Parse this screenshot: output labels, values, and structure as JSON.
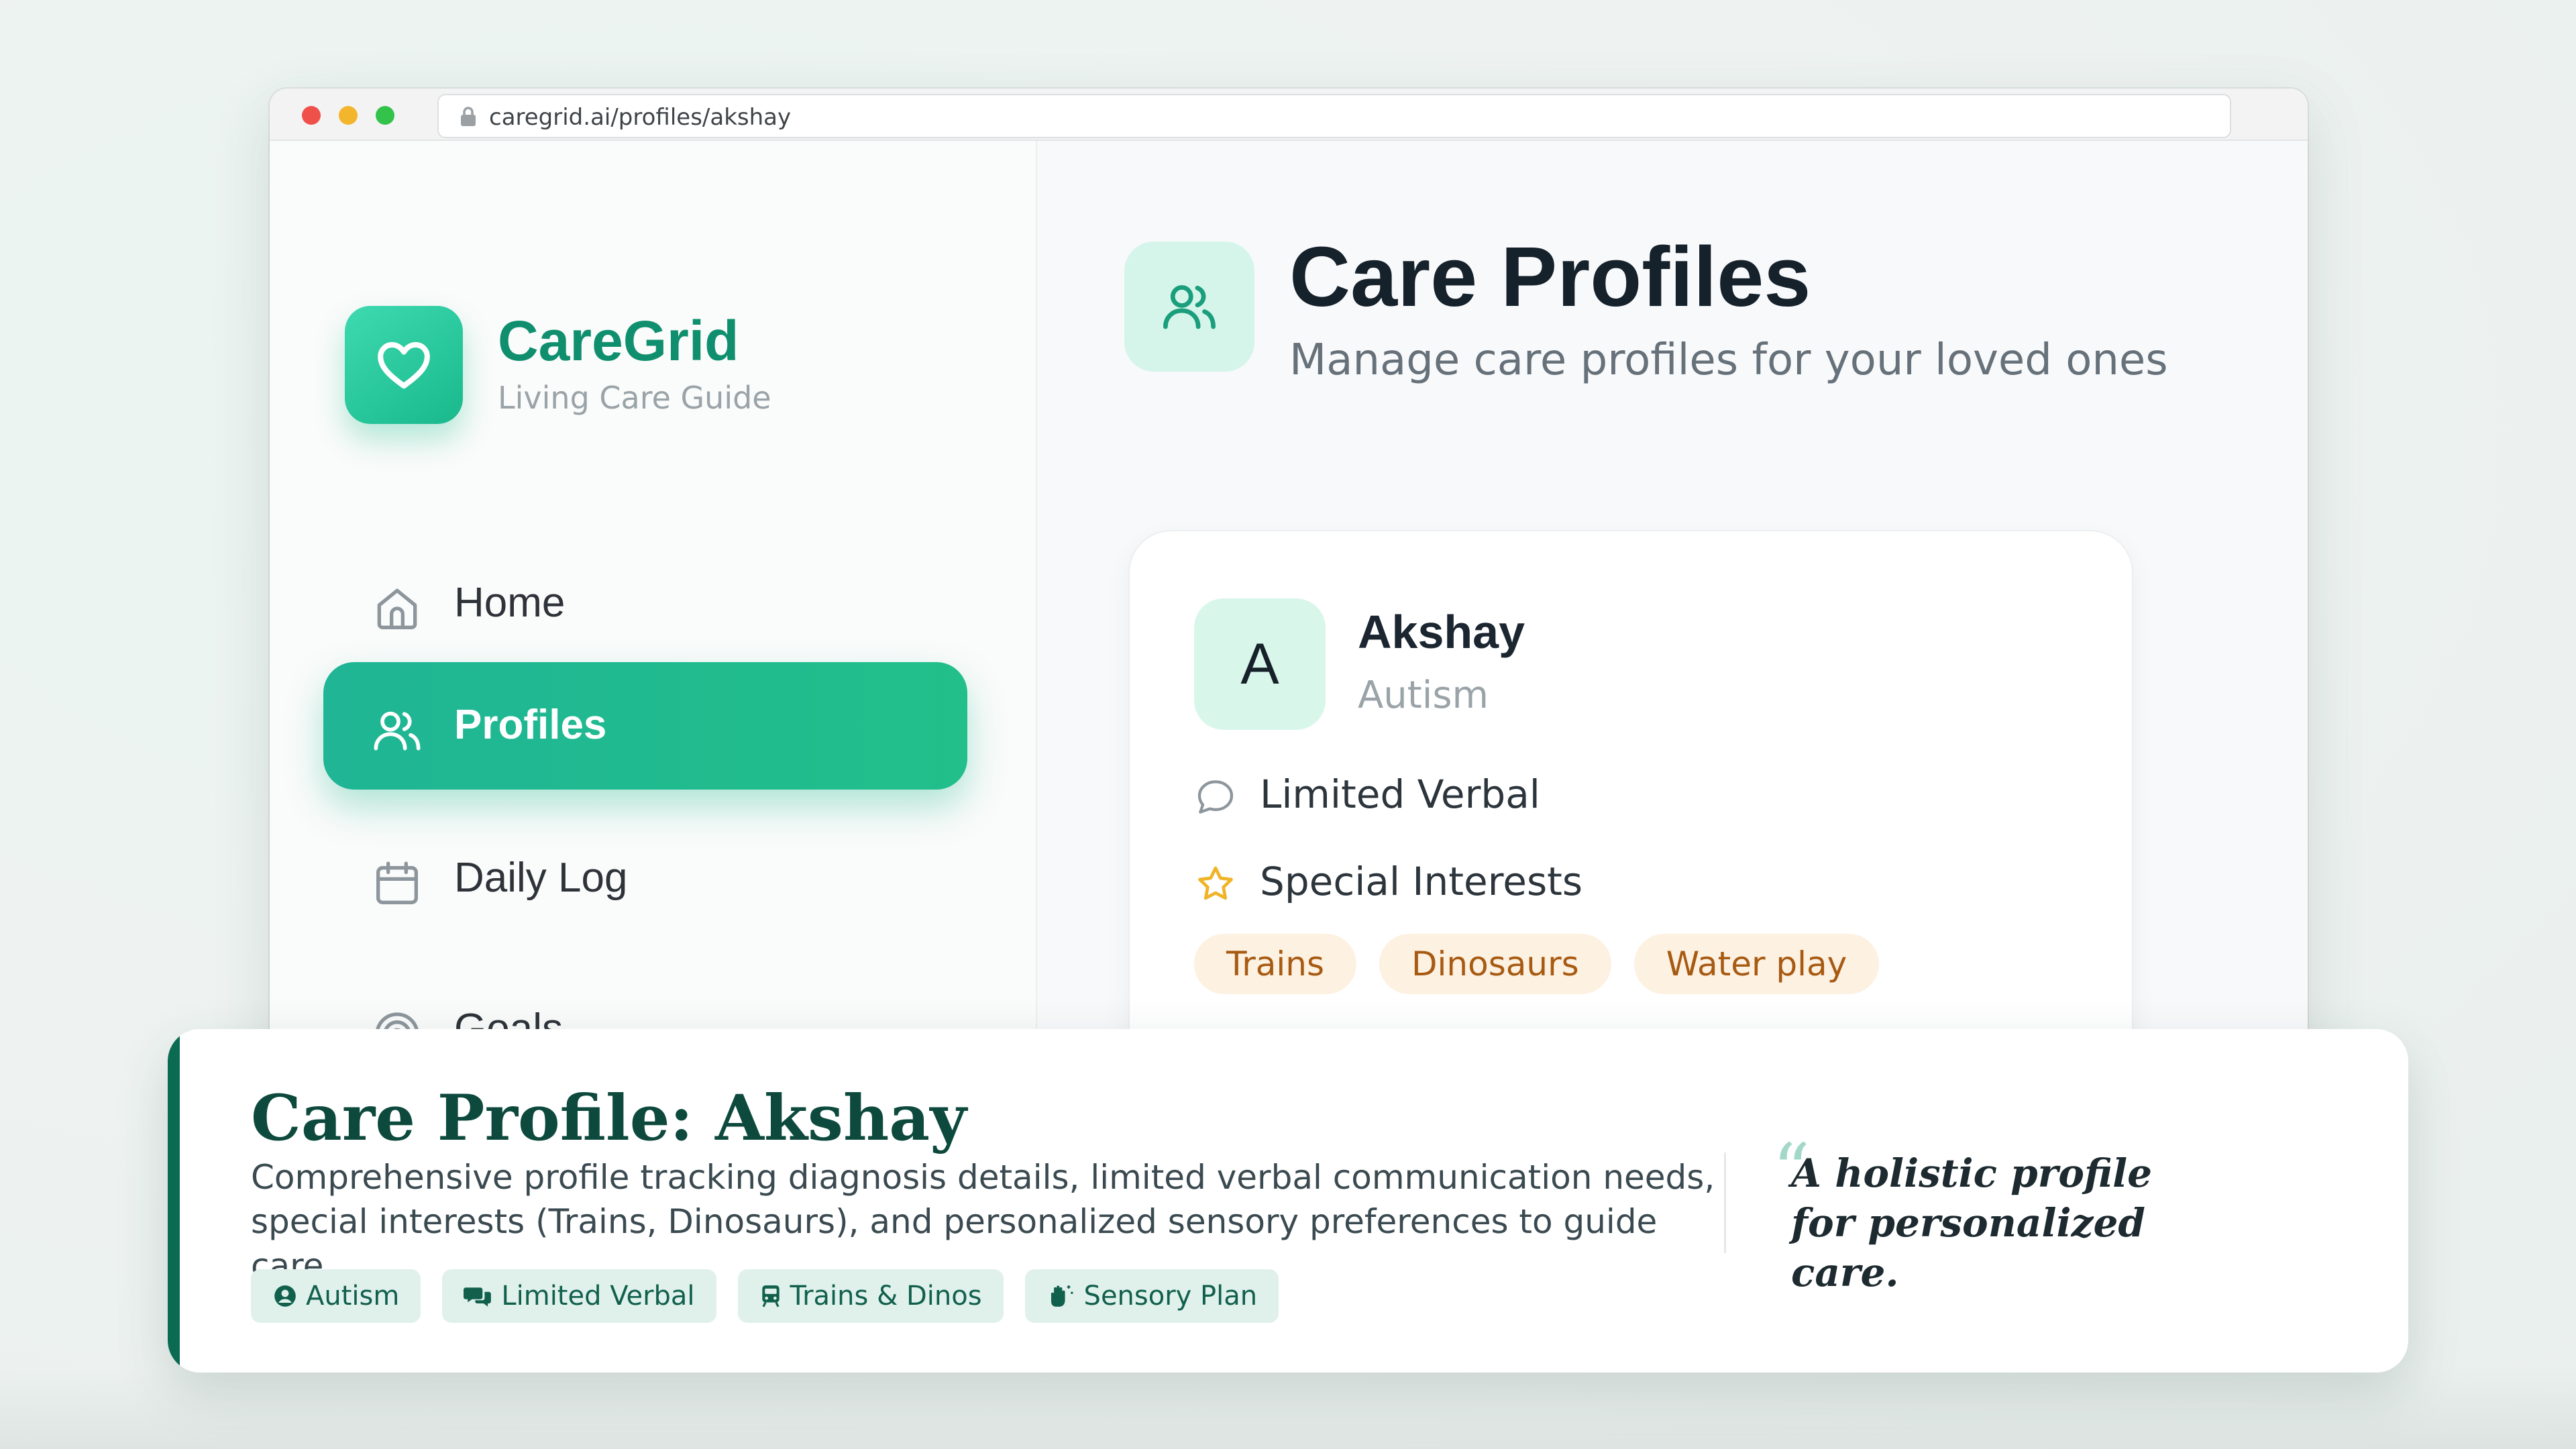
{
  "browser": {
    "url": "caregrid.ai/profiles/akshay"
  },
  "sidebar": {
    "brand_name": "CareGrid",
    "brand_tagline": "Living Care Guide",
    "items": [
      {
        "label": "Home",
        "icon": "home-icon",
        "active": false
      },
      {
        "label": "Profiles",
        "icon": "users-icon",
        "active": true
      },
      {
        "label": "Daily Log",
        "icon": "calendar-icon",
        "active": false
      },
      {
        "label": "Goals",
        "icon": "target-icon",
        "active": false
      }
    ]
  },
  "header": {
    "title": "Care Profiles",
    "subtitle": "Manage care profiles for your loved ones",
    "icon": "users-icon"
  },
  "profile_card": {
    "avatar_letter": "A",
    "name": "Akshay",
    "diagnosis": "Autism",
    "communication": "Limited Verbal",
    "interests_label": "Special Interests",
    "interests": [
      "Trains",
      "Dinosaurs",
      "Water play"
    ]
  },
  "caption": {
    "title": "Care Profile: Akshay",
    "description": "Comprehensive profile tracking diagnosis details, limited verbal communication needs, special interests (Trains, Dinosaurs), and personalized sensory preferences to guide care.",
    "tags": [
      {
        "label": "Autism",
        "icon": "user-circle-icon"
      },
      {
        "label": "Limited Verbal",
        "icon": "comments-icon"
      },
      {
        "label": "Trains & Dinos",
        "icon": "train-icon"
      },
      {
        "label": "Sensory Plan",
        "icon": "hand-sparkle-icon"
      }
    ],
    "quote_mark": "“",
    "quote": "A holistic profile for personalized care."
  },
  "colors": {
    "brand_green": "#1fb595",
    "brand_dark": "#0d4a3d",
    "chip_bg": "#fdf1e1",
    "chip_text": "#a75a12",
    "star": "#f0b429"
  }
}
